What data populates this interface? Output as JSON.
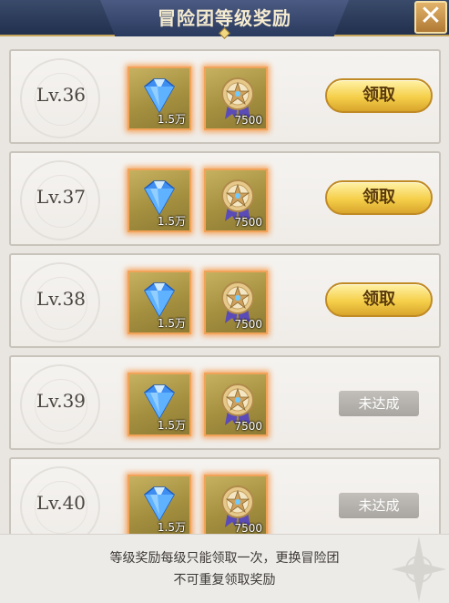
{
  "header": {
    "title": "冒险团等级奖励",
    "close_label": "✕"
  },
  "rows": [
    {
      "level": "Lv.36",
      "gem_qty": "1.5万",
      "medal_qty": "7500",
      "action": "领取",
      "claimable": true
    },
    {
      "level": "Lv.37",
      "gem_qty": "1.5万",
      "medal_qty": "7500",
      "action": "领取",
      "claimable": true
    },
    {
      "level": "Lv.38",
      "gem_qty": "1.5万",
      "medal_qty": "7500",
      "action": "领取",
      "claimable": true
    },
    {
      "level": "Lv.39",
      "gem_qty": "1.5万",
      "medal_qty": "7500",
      "action": "未达成",
      "claimable": false
    },
    {
      "level": "Lv.40",
      "gem_qty": "1.5万",
      "medal_qty": "7500",
      "action": "未达成",
      "claimable": false
    }
  ],
  "footer": {
    "line1": "等级奖励每级只能领取一次，更换冒险团",
    "line2": "不可重复领取奖励"
  },
  "icons": {
    "gem": "blue-diamond-icon",
    "medal": "star-medal-icon",
    "close": "close-icon"
  },
  "colors": {
    "claim": "#f5cf4a",
    "disabled": "#b2afaa",
    "header": "#2a3a5e",
    "item_glow": "#f58c32"
  }
}
